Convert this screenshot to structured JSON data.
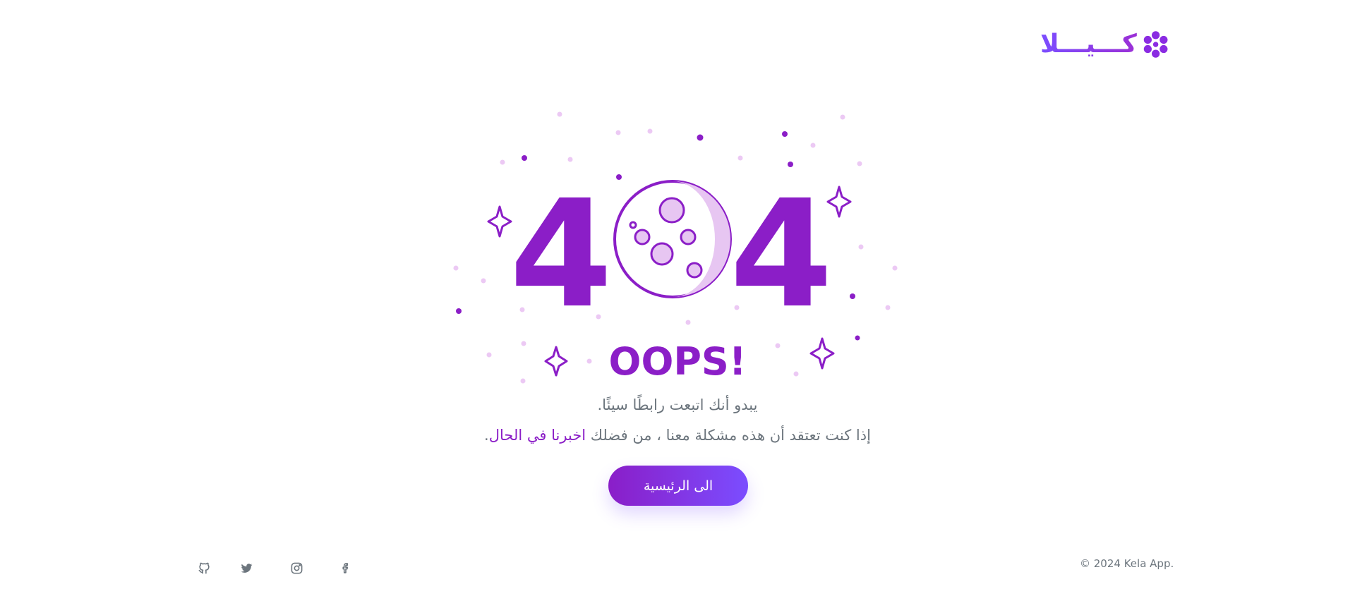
{
  "brand": {
    "logo_text": "كـــيـــلا"
  },
  "error": {
    "code_left": "4",
    "code_right": "4",
    "heading": "OOPS!",
    "message": "يبدو أنك اتبعت رابطًا سيئًا.",
    "report_prefix": "إذا كنت تعتقد أن هذه مشكلة معنا ، من فضلك ",
    "report_link": "اخبرنا في الحال",
    "report_suffix": "."
  },
  "actions": {
    "home_label": "الى الرئيسية"
  },
  "footer": {
    "copyright": "© 2024 Kela App.",
    "social": [
      "facebook-icon",
      "instagram-icon",
      "twitter-icon",
      "github-icon"
    ]
  },
  "colors": {
    "primary": "#8b1ec7",
    "accent": "#7b4dff",
    "muted_text": "#6c757d",
    "moon_fill": "#e7c6f2"
  }
}
